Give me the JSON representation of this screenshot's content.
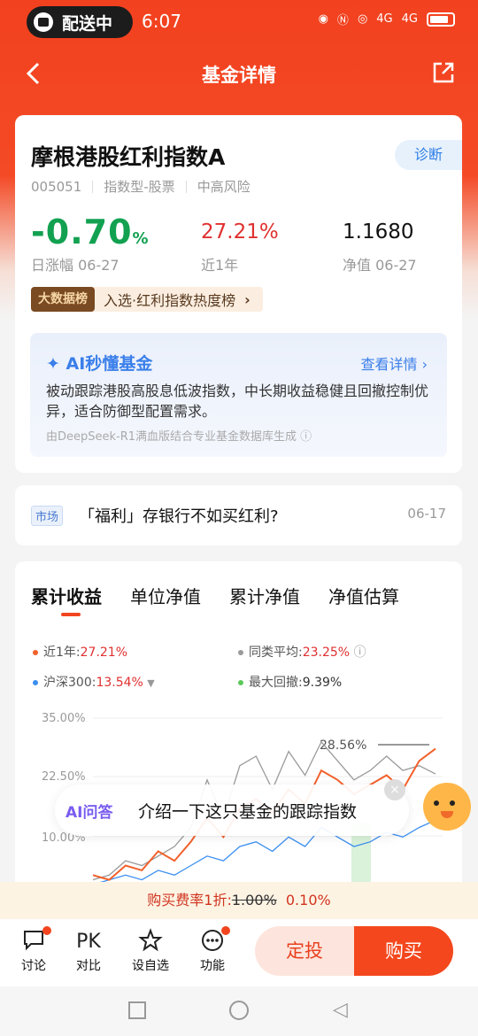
{
  "status_bar": {
    "pill_text": "配送中",
    "time": "6:07",
    "net1": "4G",
    "net2": "4G"
  },
  "nav": {
    "title": "基金详情"
  },
  "fund": {
    "name": "摩根港股红利指数A",
    "diagnose": "诊断",
    "code": "005051",
    "type": "指数型-股票",
    "risk": "中高风险",
    "daily_change": "-0.70",
    "daily_unit": "%",
    "daily_label": "日涨幅 06-27",
    "year_return": "27.21%",
    "year_label": "近1年",
    "nav_value": "1.1680",
    "nav_label": "净值 06-27",
    "bigdata_badge": "大数据榜",
    "bigdata_text": "入选·红利指数热度榜"
  },
  "ai_summary": {
    "title": "AI秒懂基金",
    "more": "查看详情",
    "text": "被动跟踪港股高股息低波指数，中长期收益稳健且回撤控制优异，适合防御型配置需求。",
    "footer": "由DeepSeek-R1满血版结合专业基金数据库生成"
  },
  "news": {
    "tag": "市场",
    "title": "「福利」存银行不如买红利?",
    "date": "06-17"
  },
  "chart": {
    "tabs": [
      "累计收益",
      "单位净值",
      "累计净值",
      "净值估算"
    ],
    "legend": {
      "year_label": "近1年:",
      "year_value": "27.21%",
      "peer_label": "同类平均:",
      "peer_value": "23.25%",
      "hs300_label": "沪深300:",
      "hs300_value": "13.54%",
      "drawdown_label": "最大回撤:",
      "drawdown_value": "9.39%"
    },
    "peak_label": "28.56%",
    "colors": {
      "fund": "#f2602a",
      "peer": "#9a9a9a",
      "hs300": "#3b8ff0",
      "drawdown": "#5cc85c"
    }
  },
  "chart_data": {
    "type": "line",
    "yticks": [
      "35.00%",
      "22.50%",
      "10.00%"
    ],
    "ylim": [
      0,
      35
    ],
    "series": [
      {
        "name": "近1年",
        "values": [
          2,
          1,
          4,
          3,
          7,
          5,
          9,
          14,
          10,
          16,
          18,
          15,
          20,
          17,
          24,
          22,
          19,
          21,
          23,
          20,
          26,
          28.56
        ]
      },
      {
        "name": "同类平均",
        "values": [
          1,
          2,
          5,
          4,
          6,
          8,
          12,
          22,
          14,
          25,
          27,
          20,
          28,
          23,
          30,
          26,
          22,
          24,
          27,
          24,
          25,
          23.25
        ]
      },
      {
        "name": "沪深300",
        "values": [
          0,
          1,
          2,
          1,
          3,
          2,
          4,
          6,
          5,
          8,
          9,
          7,
          10,
          8,
          12,
          10,
          8,
          9,
          11,
          10,
          12,
          13.54
        ]
      }
    ]
  },
  "ai_float": {
    "tag": "AI问答",
    "question": "介绍一下这只基金的跟踪指数"
  },
  "fee": {
    "prefix": "购买费率1折:",
    "old": "1.00%",
    "new": "0.10%"
  },
  "bottom": {
    "discuss": "讨论",
    "compare_icon": "PK",
    "compare": "对比",
    "watch": "设自选",
    "features": "功能",
    "dingtou": "定投",
    "buy": "购买"
  }
}
